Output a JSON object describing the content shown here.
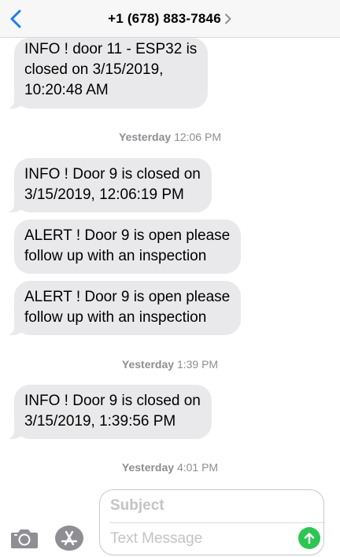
{
  "header": {
    "title": "+1 (678) 883-7846",
    "accent_color": "#1a7cf5",
    "back_icon": "chevron-left-icon",
    "title_chevron_icon": "chevron-right-icon"
  },
  "messages": [
    {
      "lines": [
        "INFO ! door 11 - ESP32  is",
        "closed on 3/15/2019,",
        "10:20:48 AM"
      ]
    },
    {
      "lines": [
        "INFO ! Door 9 is closed on",
        "3/15/2019, 12:06:19 PM"
      ]
    },
    {
      "lines": [
        "ALERT ! Door 9 is open please",
        "follow up with an inspection"
      ]
    },
    {
      "lines": [
        "ALERT ! Door 9 is open please",
        "follow up with an inspection"
      ]
    },
    {
      "lines": [
        "INFO ! Door 9 is closed on",
        "3/15/2019, 1:39:56 PM"
      ]
    }
  ],
  "timestamps": [
    {
      "day": "Yesterday",
      "time": "12:06 PM"
    },
    {
      "day": "Yesterday",
      "time": "1:39 PM"
    },
    {
      "day": "Yesterday",
      "time": "4:01 PM"
    }
  ],
  "composer": {
    "subject_placeholder": "Subject",
    "message_placeholder": "Text Message",
    "send_color": "#2dc553",
    "camera_icon": "camera-icon",
    "appstore_icon": "app-store-icon",
    "send_icon": "arrow-up-icon"
  }
}
